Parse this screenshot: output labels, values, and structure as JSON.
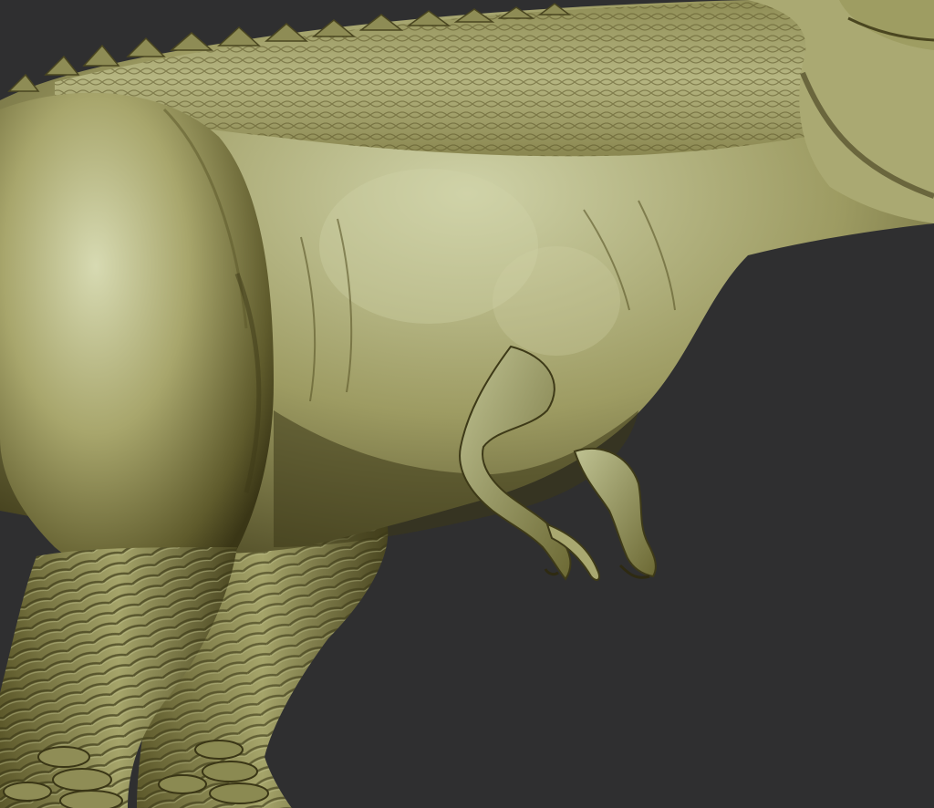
{
  "scene": {
    "subject": "sculpted-dinosaur-model",
    "colors": {
      "background": "#2f2f30",
      "skin_light": "#cfd2a8",
      "skin_mid": "#9a9a5e",
      "skin_dark": "#4d4a22",
      "skin_shadow": "#2e2a12"
    }
  }
}
